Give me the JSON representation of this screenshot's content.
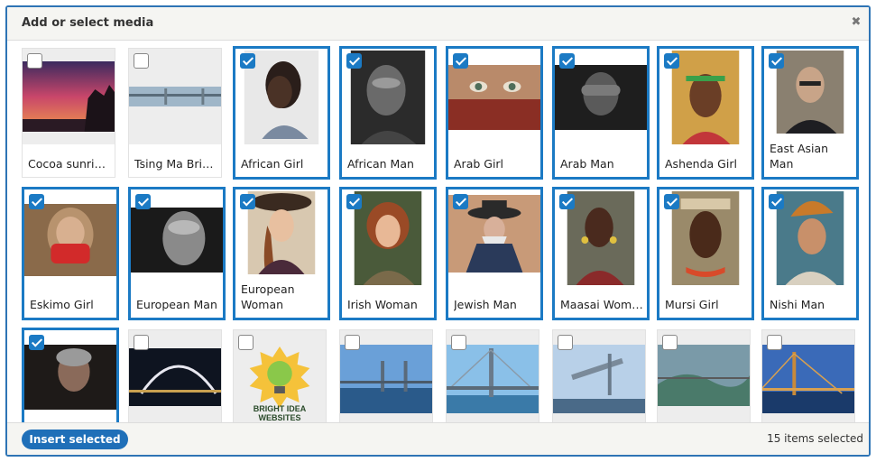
{
  "dialog": {
    "title": "Add or select media",
    "close_icon": "close-icon"
  },
  "footer": {
    "insert_label": "Insert selected",
    "count_text": "15 items selected"
  },
  "media": [
    {
      "label": "Cocoa sunri…",
      "selected": false
    },
    {
      "label": "Tsing Ma Bri…",
      "selected": false
    },
    {
      "label": "African Girl",
      "selected": true
    },
    {
      "label": "African Man",
      "selected": true
    },
    {
      "label": "Arab Girl",
      "selected": true
    },
    {
      "label": "Arab Man",
      "selected": true
    },
    {
      "label": "Ashenda Girl",
      "selected": true
    },
    {
      "label": "East Asian Man",
      "selected": true
    },
    {
      "label": "Eskimo Girl",
      "selected": true
    },
    {
      "label": "European Man",
      "selected": true
    },
    {
      "label": "European Woman",
      "selected": true
    },
    {
      "label": "Irish Woman",
      "selected": true
    },
    {
      "label": "Jewish Man",
      "selected": true
    },
    {
      "label": "Maasai Woman",
      "selected": true
    },
    {
      "label": "Mursi Girl",
      "selected": true
    },
    {
      "label": "Nishi Man",
      "selected": true
    },
    {
      "label": "",
      "selected": true
    },
    {
      "label": "",
      "selected": false
    },
    {
      "label": "",
      "selected": false,
      "logo_text": "BRIGHT IDEA WEBSITES"
    },
    {
      "label": "",
      "selected": false
    },
    {
      "label": "",
      "selected": false
    },
    {
      "label": "",
      "selected": false
    },
    {
      "label": "",
      "selected": false
    },
    {
      "label": "",
      "selected": false
    }
  ]
}
